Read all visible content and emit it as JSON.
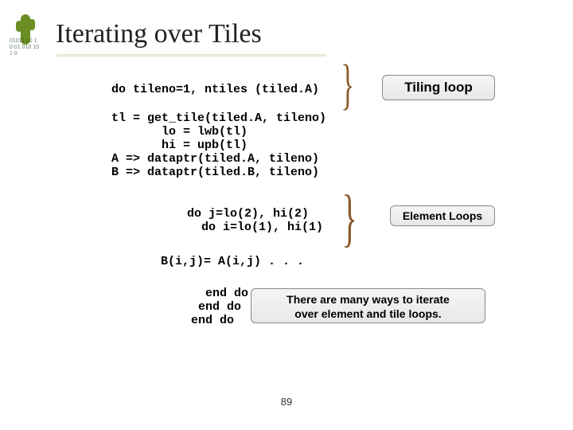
{
  "title": "Iterating over Tiles",
  "logo_lines": "01011\n10 1 0\n01 010\n10 1 0",
  "code": {
    "line1": "do tileno=1, ntiles (tiled.A)",
    "block2": "tl = get_tile(tiled.A, tileno)\n       lo = lwb(tl)\n       hi = upb(tl)\nA => dataptr(tiled.A, tileno)\nB => dataptr(tiled.B, tileno)",
    "block3": "do j=lo(2), hi(2)\n  do i=lo(1), hi(1)",
    "line4": "B(i,j)= A(i,j) . . .",
    "block5": "  end do\n end do\nend do"
  },
  "labels": {
    "tiling_loop": "Tiling loop",
    "element_loops": "Element Loops",
    "note_l1": "There are many ways to iterate",
    "note_l2": "over element and tile loops."
  },
  "page_number": "89"
}
